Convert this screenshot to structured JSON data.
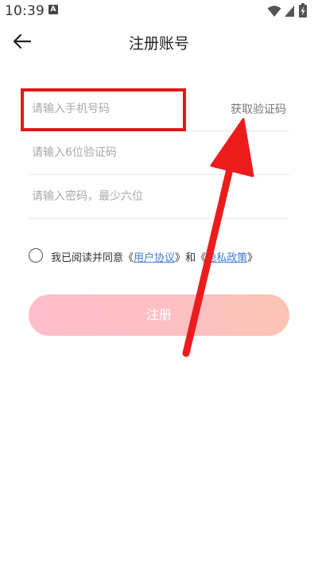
{
  "status_bar": {
    "time": "10:39",
    "a_badge": "A",
    "icons": [
      "wifi-icon",
      "signal-icon",
      "battery-charging-icon"
    ]
  },
  "nav": {
    "back_icon": "arrow-left-icon",
    "title": "注册账号"
  },
  "form": {
    "phone_placeholder": "请输入手机号码",
    "get_code_label": "获取验证码",
    "code_placeholder": "请输入6位验证码",
    "password_placeholder": "请输入密码，最少六位"
  },
  "agreement": {
    "prefix": "我已阅读并同意",
    "open_quote_1": "《",
    "user_agreement": "用户协议",
    "close_quote_1": "》",
    "and_text": "和",
    "open_quote_2": "《",
    "privacy_policy": "隐私政策",
    "close_quote_2": "》"
  },
  "register": {
    "label": "注册"
  },
  "colors": {
    "annotation_red": "#e1191a",
    "link_blue": "#3d7fd8",
    "button_gradient_start": "#fdbdca",
    "button_gradient_end": "#fdc4b4"
  }
}
